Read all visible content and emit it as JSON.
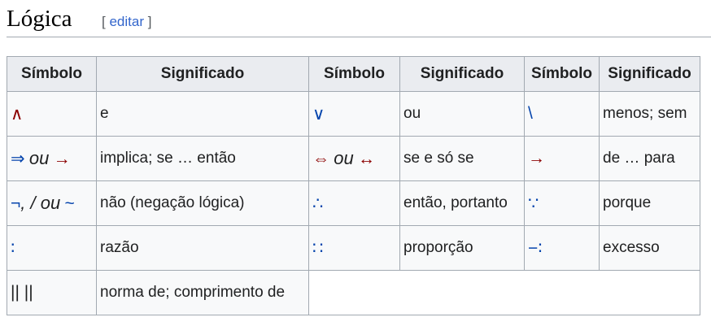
{
  "heading": {
    "title": "Lógica",
    "edit_open": "[ ",
    "edit_label": "editar",
    "edit_close": " ]"
  },
  "table": {
    "headers": [
      "Símbolo",
      "Significado",
      "Símbolo",
      "Significado",
      "Símbolo",
      "Significado"
    ],
    "row1": {
      "s1": "∧",
      "m1": "e",
      "s2": "∨",
      "m2": "ou",
      "s3": "\\",
      "m3": "menos; sem"
    },
    "row2": {
      "s1a": "⇒",
      "s1_ou": "ou",
      "s1b": "→",
      "m1": "implica; se … então",
      "s2a": "⇔",
      "s2_ou": "ou",
      "s2b": "↔",
      "m2": "se e só se",
      "s3": "→",
      "m3": "de … para"
    },
    "row3": {
      "s1a": "¬",
      "s1_sep": ", / ",
      "s1_ou": "ou",
      "s1b": "~",
      "m1": "não (negação lógica)",
      "s2": "∴",
      "m2": "então, portanto",
      "s3": "∵",
      "m3": "porque"
    },
    "row4": {
      "s1": "∶",
      "m1": "razão",
      "s2": "∷",
      "m2": "proporção",
      "s3": "−∶",
      "m3": "excesso"
    },
    "row5": {
      "s1": "|| ||",
      "m1": "norma de; comprimento de"
    }
  },
  "colors": {
    "red_symbol": "#8b0000",
    "blue_symbol": "#0645ad",
    "link": "#3366cc",
    "border": "#a2a9b1",
    "header_bg": "#eaecf0",
    "cell_bg": "#f8f9fa"
  }
}
